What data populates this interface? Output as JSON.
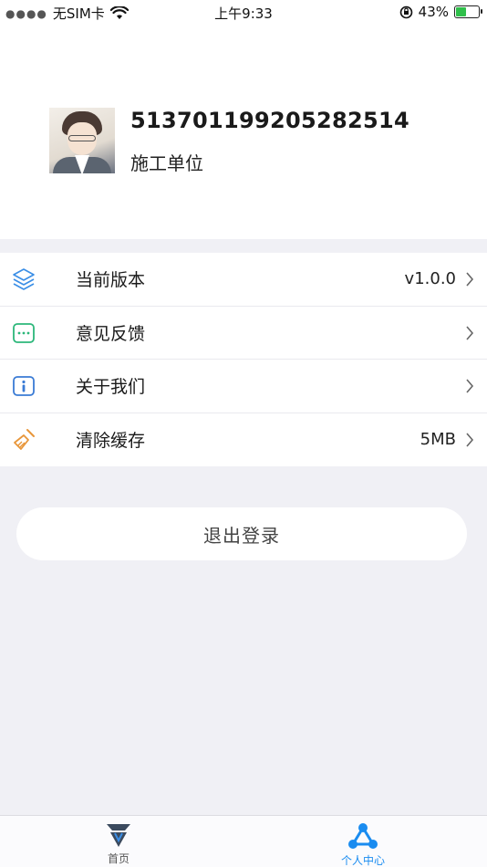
{
  "status_bar": {
    "carrier": "无SIM卡",
    "time": "上午9:33",
    "battery": "43%"
  },
  "profile": {
    "user_id": "513701199205282514",
    "organization": "施工单位"
  },
  "menu": {
    "items": [
      {
        "label": "当前版本",
        "value": "v1.0.0",
        "icon": "layers-icon"
      },
      {
        "label": "意见反馈",
        "value": "",
        "icon": "chat-bubble-icon"
      },
      {
        "label": "关于我们",
        "value": "",
        "icon": "info-icon"
      },
      {
        "label": "清除缓存",
        "value": "5MB",
        "icon": "broom-icon"
      }
    ]
  },
  "logout_label": "退出登录",
  "tabbar": {
    "tabs": [
      {
        "label": "首页",
        "icon": "home-diamond-icon",
        "active": false
      },
      {
        "label": "个人中心",
        "icon": "user-network-icon",
        "active": true
      }
    ]
  },
  "colors": {
    "accent": "#1a8cf0",
    "layers_icon": "#3a8ee6",
    "chat_icon": "#2cb77a",
    "info_icon": "#3a7bd5",
    "broom_icon": "#e8963a",
    "background": "#f0f0f5"
  }
}
